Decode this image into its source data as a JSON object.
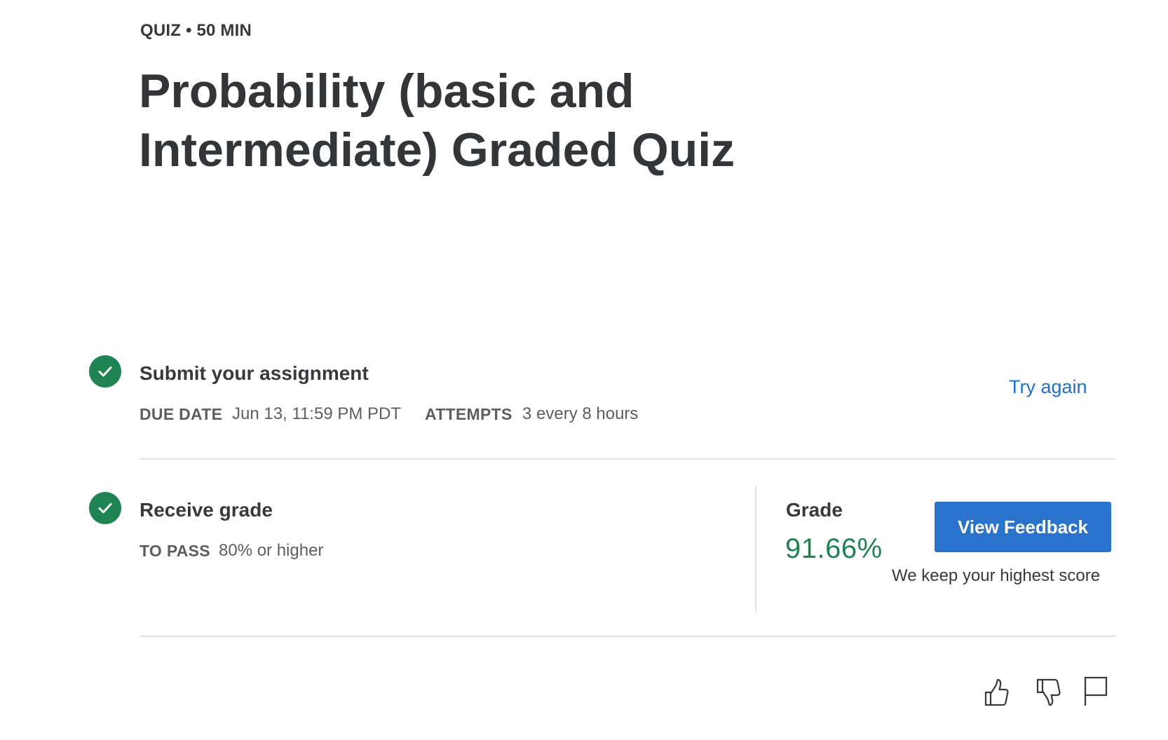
{
  "header": {
    "eyebrow": "QUIZ • 50 MIN",
    "title": "Probability (basic and Intermediate) Graded Quiz"
  },
  "submit_step": {
    "icon": "check-circle-icon",
    "title": "Submit your assignment",
    "due_date_label": "DUE DATE",
    "due_date_value": "Jun 13, 11:59 PM PDT",
    "attempts_label": "ATTEMPTS",
    "attempts_value": "3 every 8 hours",
    "try_again_label": "Try again"
  },
  "grade_step": {
    "icon": "check-circle-icon",
    "title": "Receive grade",
    "to_pass_label": "TO PASS",
    "to_pass_value": "80% or higher",
    "grade_label": "Grade",
    "grade_value": "91.66%",
    "view_feedback_label": "View Feedback",
    "highest_score_note": "We keep your highest score"
  },
  "footer_actions": {
    "like_icon": "thumbs-up-icon",
    "dislike_icon": "thumbs-down-icon",
    "report_icon": "flag-icon"
  },
  "colors": {
    "success": "#1f8354",
    "link": "#1f6fd0",
    "primary_button": "#2a73cc",
    "text": "#373a3c",
    "divider": "#e2e3e4"
  }
}
